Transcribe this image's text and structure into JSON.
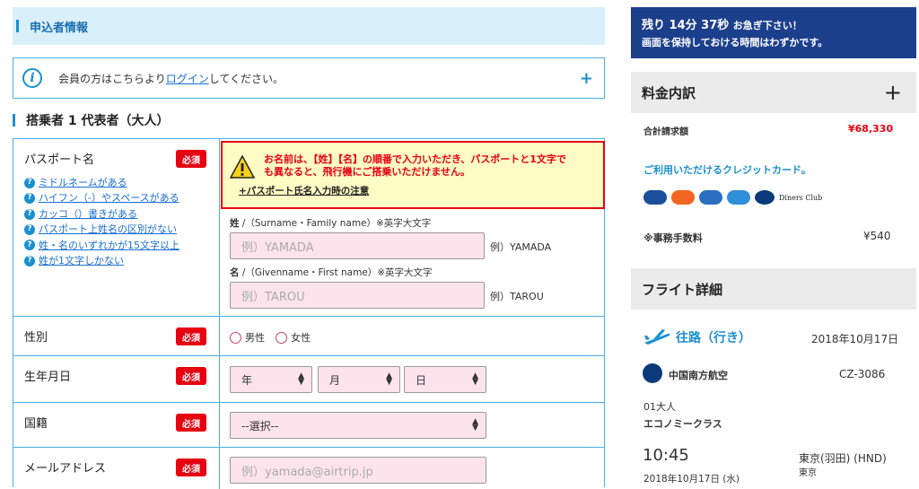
{
  "applicant_section": {
    "title": "申込者情報"
  },
  "login_notice": {
    "text_before": "会員の方はこちらより",
    "link": "ログイン",
    "text_after": "してください。",
    "expand": "+"
  },
  "passenger": {
    "title": "搭乗者 1 代表者（大人）"
  },
  "required_label": "必須",
  "passport_name": {
    "label": "パスポート名",
    "help_links": [
      "ミドルネームがある",
      "ハイフン（-）やスペースがある",
      "カッコ（）書きがある",
      "パスポート上姓名の区別がない",
      "姓・名のいずれかが15文字以上",
      "姓が1文字しかない"
    ],
    "warning_line1": "お名前は、【姓】【名】の順番で入力いただき、パスポートと1文字で",
    "warning_line2": "も異なると、飛行機にご搭乗いただけません。",
    "warning_link": "+パスポート氏名入力時の注意",
    "surname_label": "姓",
    "surname_sub": "/（Surname・Family name）※英字大文字",
    "surname_placeholder": "例）YAMADA",
    "surname_example": "例）YAMADA",
    "given_label": "名",
    "given_sub": "/（Givenname・First name）※英字大文字",
    "given_placeholder": "例）TAROU",
    "given_example": "例）TAROU"
  },
  "gender": {
    "label": "性別",
    "options": [
      "男性",
      "女性"
    ]
  },
  "birthdate": {
    "label": "生年月日",
    "year": "年",
    "month": "月",
    "day": "日"
  },
  "nationality": {
    "label": "国籍",
    "selected": "--選択--"
  },
  "email": {
    "label": "メールアドレス",
    "placeholder": "例）yamada@airtrip.jp"
  },
  "timer": {
    "remaining": "残り",
    "minutes": "14分",
    "seconds": "37秒",
    "hurry": "お急ぎ下さい！",
    "line2": "画面を保持しておける時間はわずかです。"
  },
  "fees": {
    "title": "料金内訳",
    "expand": "+",
    "total_label": "合計請求額",
    "total_value": "¥68,330",
    "cards_label": "ご利用いただけるクレジットカード。",
    "card_names": [
      "VISA",
      "MasterCard",
      "JCB",
      "American Express",
      "Diners Club"
    ],
    "fee_label": "※事務手数料",
    "fee_value": "¥540"
  },
  "flight": {
    "title": "フライト詳細",
    "direction": "往路（行き）",
    "date": "2018年10月17日",
    "airline": "中国南方航空",
    "flight_no": "CZ-3086",
    "pax": "01大人",
    "cabin": "エコノミークラス",
    "dep_time": "10:45",
    "dep_date": "2018年10月17日 (水)",
    "dep_airport": "東京(羽田) (HND)",
    "dep_city": "東京"
  },
  "colors": {
    "accent": "#1a8fd0",
    "required": "#e60012",
    "timer_bg": "#1c3f8c"
  }
}
